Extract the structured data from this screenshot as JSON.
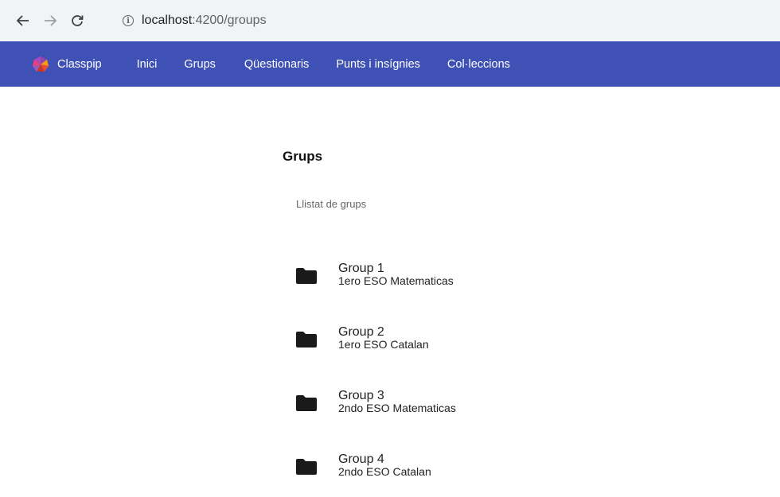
{
  "browser": {
    "url_host": "localhost",
    "url_path": ":4200/groups",
    "info_icon": "info-icon",
    "back_icon": "arrow-left-icon",
    "forward_icon": "arrow-right-icon",
    "reload_icon": "reload-icon"
  },
  "toolbar": {
    "color": "#3f51b5",
    "brand": "Classpip",
    "menu": [
      "Inici",
      "Grups",
      "Qüestionaris",
      "Punts i insígnies",
      "Col·leccions"
    ]
  },
  "main": {
    "title": "Grups",
    "subheader": "Llistat de grups",
    "groups": [
      {
        "name": "Group 1",
        "description": "1ero ESO Matematicas",
        "icon": "folder-icon"
      },
      {
        "name": "Group 2",
        "description": "1ero ESO Catalan",
        "icon": "folder-icon"
      },
      {
        "name": "Group 3",
        "description": "2ndo ESO Matematicas",
        "icon": "folder-icon"
      },
      {
        "name": "Group 4",
        "description": "2ndo ESO Catalan",
        "icon": "folder-icon"
      }
    ]
  }
}
